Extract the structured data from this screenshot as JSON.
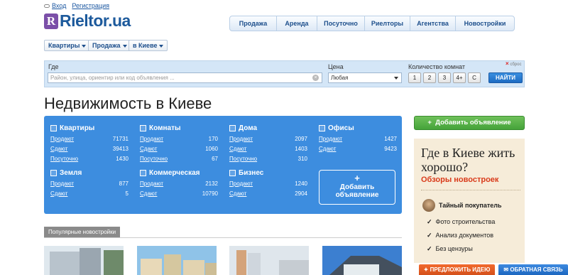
{
  "header": {
    "login": "Вход",
    "register": "Регистрация",
    "logo_mark": "R",
    "logo_text": "Rieltor.ua"
  },
  "nav": [
    "Продажа",
    "Аренда",
    "Посуточно",
    "Риелторы",
    "Агентства",
    "Новостройки"
  ],
  "filters": {
    "type": "Квартиры",
    "deal": "Продажа",
    "city": "в Киеве"
  },
  "search": {
    "where_label": "Где",
    "where_placeholder": "Район, улица, ориентир или код объявления ...",
    "price_label": "Цена",
    "price_value": "Любая",
    "rooms_label": "Количество комнат",
    "rooms": [
      "1",
      "2",
      "3",
      "4+",
      "С"
    ],
    "find": "НАЙТИ",
    "reset": "сброс"
  },
  "page_title": "Недвижимость в Киеве",
  "categories": [
    {
      "title": "Квартиры",
      "rows": [
        {
          "label": "Продают",
          "count": "71731"
        },
        {
          "label": "Сдают",
          "count": "39413"
        },
        {
          "label": "Посуточно",
          "count": "1430"
        }
      ]
    },
    {
      "title": "Комнаты",
      "rows": [
        {
          "label": "Продают",
          "count": "170"
        },
        {
          "label": "Сдают",
          "count": "1060"
        },
        {
          "label": "Посуточно",
          "count": "67"
        }
      ]
    },
    {
      "title": "Дома",
      "rows": [
        {
          "label": "Продают",
          "count": "2097"
        },
        {
          "label": "Сдают",
          "count": "1403"
        },
        {
          "label": "Посуточно",
          "count": "310"
        }
      ]
    },
    {
      "title": "Офисы",
      "rows": [
        {
          "label": "Продают",
          "count": "1427"
        },
        {
          "label": "Сдают",
          "count": "9423"
        }
      ]
    },
    {
      "title": "Земля",
      "rows": [
        {
          "label": "Продают",
          "count": "877"
        },
        {
          "label": "Сдают",
          "count": "5"
        }
      ]
    },
    {
      "title": "Коммерческая",
      "rows": [
        {
          "label": "Продают",
          "count": "2132"
        },
        {
          "label": "Сдают",
          "count": "10790"
        }
      ]
    },
    {
      "title": "Бизнес",
      "rows": [
        {
          "label": "Продают",
          "count": "1240"
        },
        {
          "label": "Сдают",
          "count": "2904"
        }
      ]
    }
  ],
  "add_box": {
    "plus": "+",
    "line1": "Добавить",
    "line2": "объявление"
  },
  "popular_tab": "Популярные новостройки",
  "sidebar": {
    "add_button": "Добавить объявление",
    "promo_title": "Где в Киеве жить хорошо?",
    "promo_sub": "Обзоры новостроек",
    "buyer": "Тайный покупатель",
    "checks": [
      "Фото строительства",
      "Анализ документов",
      "Без цензуры"
    ]
  },
  "footer_buttons": {
    "idea": "ПРЕДЛОЖИТЬ ИДЕЮ",
    "feedback": "ОБРАТНАЯ СВЯЗЬ"
  }
}
